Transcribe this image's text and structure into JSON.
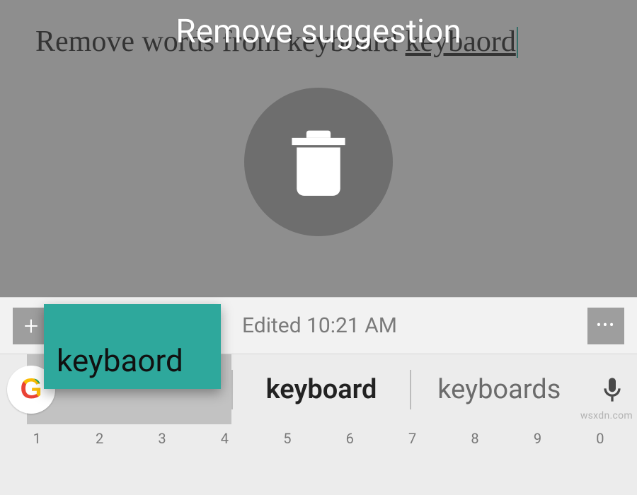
{
  "note": {
    "text_plain": "Remove words from keyboard ",
    "text_misspelled": "keybaord"
  },
  "overlay": {
    "title": "Remove suggestion"
  },
  "toolbar": {
    "add_label": "+",
    "menu_label": "•••",
    "edited_label": "Edited 10:21 AM"
  },
  "dragged": {
    "word": "keybaord"
  },
  "suggestions": {
    "left": "",
    "center": "keyboard",
    "right": "keyboards",
    "google_letter": "G"
  },
  "keyboard": {
    "numbers": [
      "1",
      "2",
      "3",
      "4",
      "5",
      "6",
      "7",
      "8",
      "9",
      "0"
    ]
  },
  "watermark": "wsxdn.com"
}
